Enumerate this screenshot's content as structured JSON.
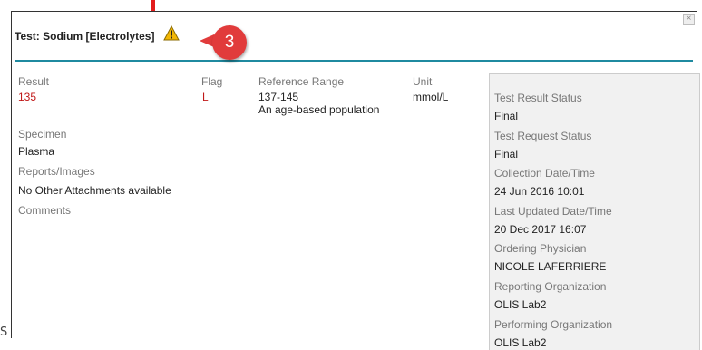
{
  "dialog": {
    "title": "Test: Sodium [Electrolytes]",
    "warning_icon": "warning-triangle-icon",
    "close_icon": "close-x-icon"
  },
  "annotation": {
    "callout_number": "3",
    "arrow_icon": "down-arrow-icon",
    "color": "#e13b3b"
  },
  "accent_color": "#1f8aa0",
  "result": {
    "result_label": "Result",
    "result_value": "135",
    "flag_label": "Flag",
    "flag_value": "L",
    "range_label": "Reference Range",
    "range_value": "137-145",
    "range_note": "An age-based population",
    "unit_label": "Unit",
    "unit_value": "mmol/L"
  },
  "details": {
    "specimen_label": "Specimen",
    "specimen_value": "Plasma",
    "reports_label": "Reports/Images",
    "reports_value": "No Other Attachments available",
    "comments_label": "Comments"
  },
  "status": [
    {
      "label": "Test Result Status",
      "value": "Final"
    },
    {
      "label": "Test Request Status",
      "value": "Final"
    },
    {
      "label": "Collection Date/Time",
      "value": "24 Jun 2016 10:01"
    },
    {
      "label": "Last Updated Date/Time",
      "value": "20 Dec 2017 16:07"
    },
    {
      "label": "Ordering Physician",
      "value": "NICOLE LAFERRIERE"
    },
    {
      "label": "Reporting Organization",
      "value": "OLIS Lab2"
    },
    {
      "label": "Performing Organization",
      "value": "OLIS Lab2"
    }
  ],
  "stray_text": "S"
}
